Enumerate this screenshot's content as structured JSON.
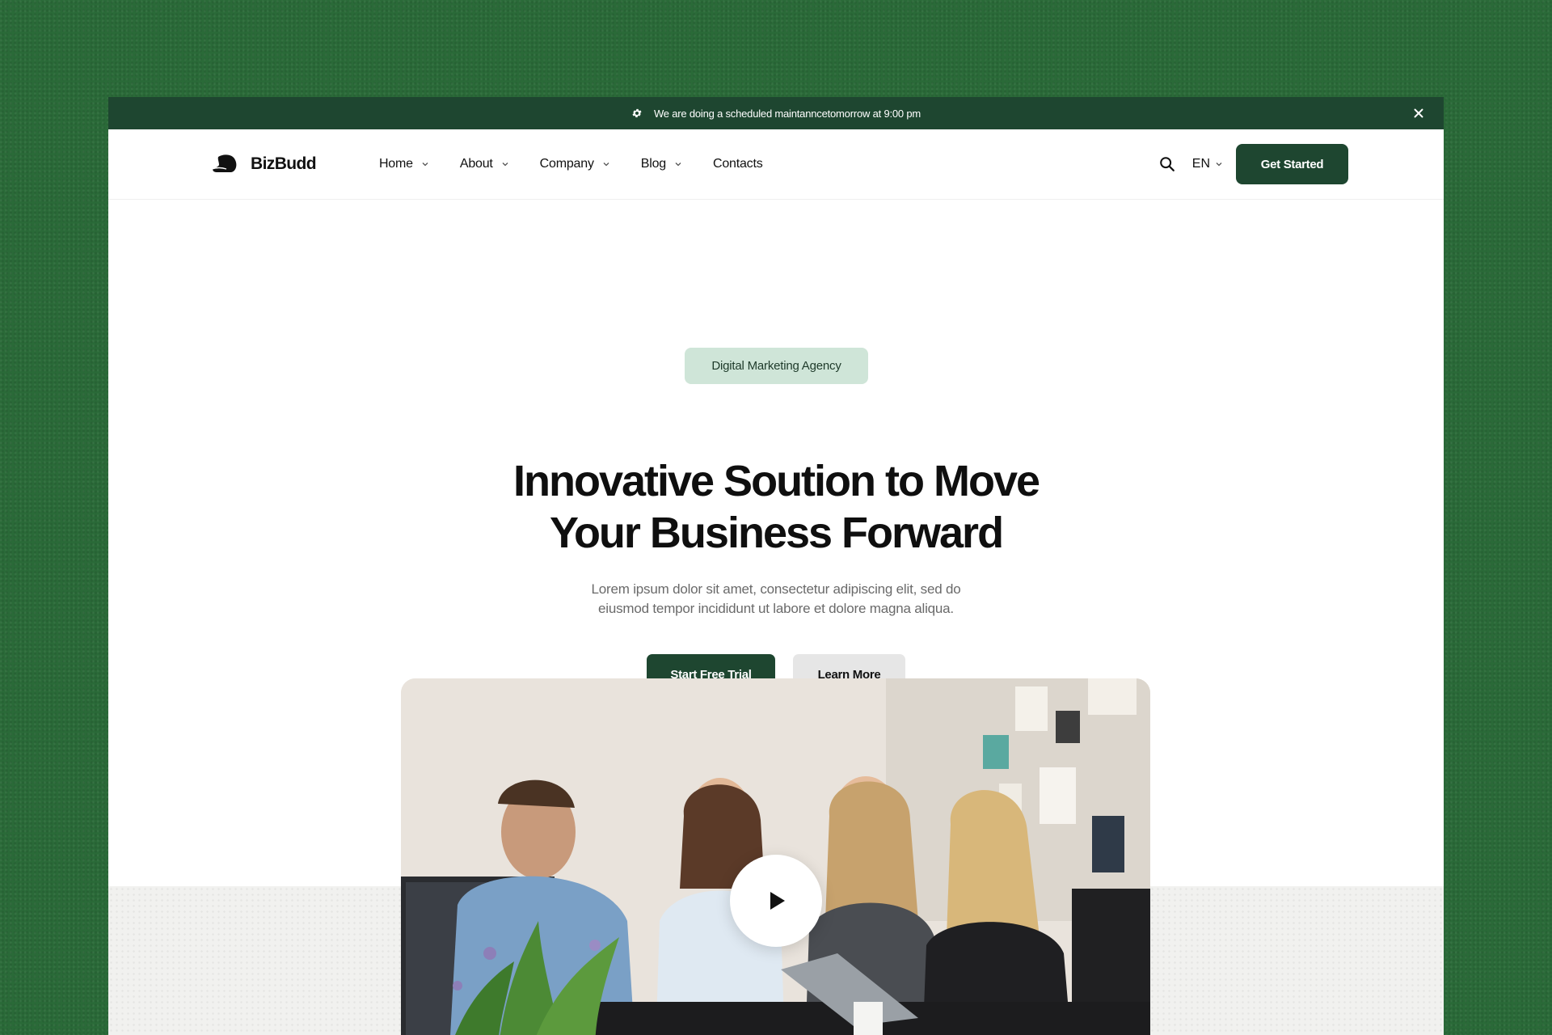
{
  "announcement": {
    "text": "We are doing a scheduled maintanncetomorrow at 9:00 pm",
    "icon": "gear-icon",
    "close_icon": "close-icon"
  },
  "brand": {
    "name": "BizBudd",
    "primary_color": "#1e4630",
    "badge_color": "#cfe5d8"
  },
  "nav": {
    "items": [
      {
        "label": "Home",
        "has_dropdown": true
      },
      {
        "label": "About",
        "has_dropdown": true
      },
      {
        "label": "Company",
        "has_dropdown": true
      },
      {
        "label": "Blog",
        "has_dropdown": true
      },
      {
        "label": "Contacts",
        "has_dropdown": false
      }
    ],
    "language": "EN",
    "cta_label": "Get Started"
  },
  "hero": {
    "badge": "Digital Marketing Agency",
    "headline_line1": "Innovative Soution to Move",
    "headline_line2": "Your Business Forward",
    "sub_line1": "Lorem ipsum dolor sit amet, consectetur adipiscing elit, sed do",
    "sub_line2": "eiusmod tempor incididunt ut labore et dolore magna aliqua.",
    "primary_cta": "Start Free Trial",
    "secondary_cta": "Learn More"
  },
  "media": {
    "play_icon": "play-icon"
  }
}
